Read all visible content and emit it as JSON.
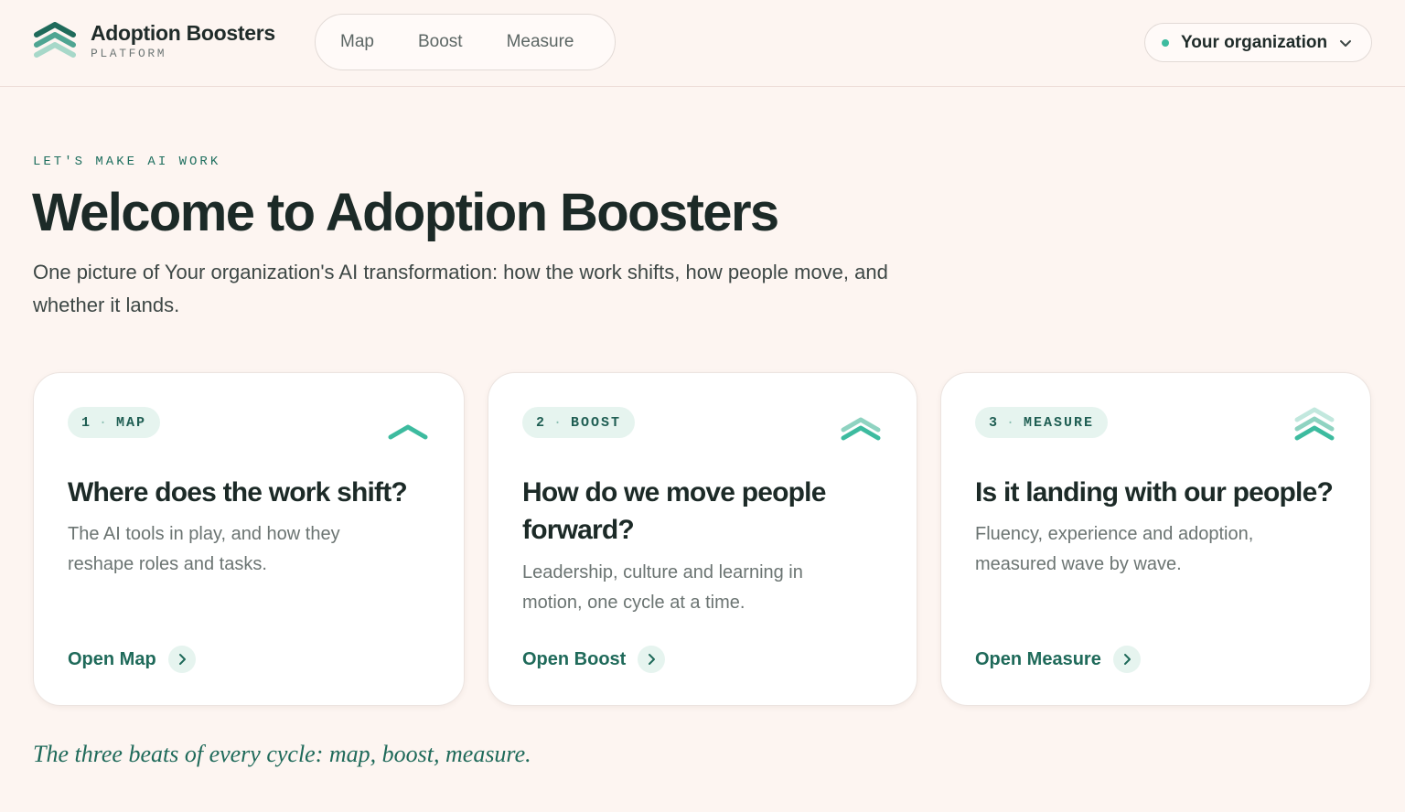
{
  "brand": {
    "name": "Adoption Boosters",
    "subtitle": "PLATFORM",
    "logo_icon": "stacked-chevrons-icon"
  },
  "nav": {
    "items": [
      {
        "label": "Map"
      },
      {
        "label": "Boost"
      },
      {
        "label": "Measure"
      }
    ]
  },
  "org_selector": {
    "label": "Your organization",
    "status_color": "#3dbb9f",
    "icon": "chevron-down-icon"
  },
  "hero": {
    "eyebrow": "LET'S MAKE AI WORK",
    "title": "Welcome to Adoption Boosters",
    "lede": "One picture of Your organization's AI transformation: how the work shifts, how people move, and whether it lands."
  },
  "cards": [
    {
      "step": "1",
      "tag": "MAP",
      "icon": "single-chevron-up-icon",
      "title": "Where does the work shift?",
      "description": "The AI tools in play, and how they reshape roles and tasks.",
      "link_label": "Open Map"
    },
    {
      "step": "2",
      "tag": "BOOST",
      "icon": "double-chevron-up-icon",
      "title": "How do we move people forward?",
      "description": "Leadership, culture and learning in motion, one cycle at a time.",
      "link_label": "Open Boost"
    },
    {
      "step": "3",
      "tag": "MEASURE",
      "icon": "triple-chevron-up-icon",
      "title": "Is it landing with our people?",
      "description": "Fluency, experience and adoption, measured wave by wave.",
      "link_label": "Open Measure"
    }
  ],
  "tagline": "The three beats of every cycle: map, boost, measure.",
  "colors": {
    "background": "#fdf5f1",
    "accent": "#1f6a5a",
    "accent_light": "#3dbb9f",
    "chip_bg": "#e6f4ef"
  }
}
